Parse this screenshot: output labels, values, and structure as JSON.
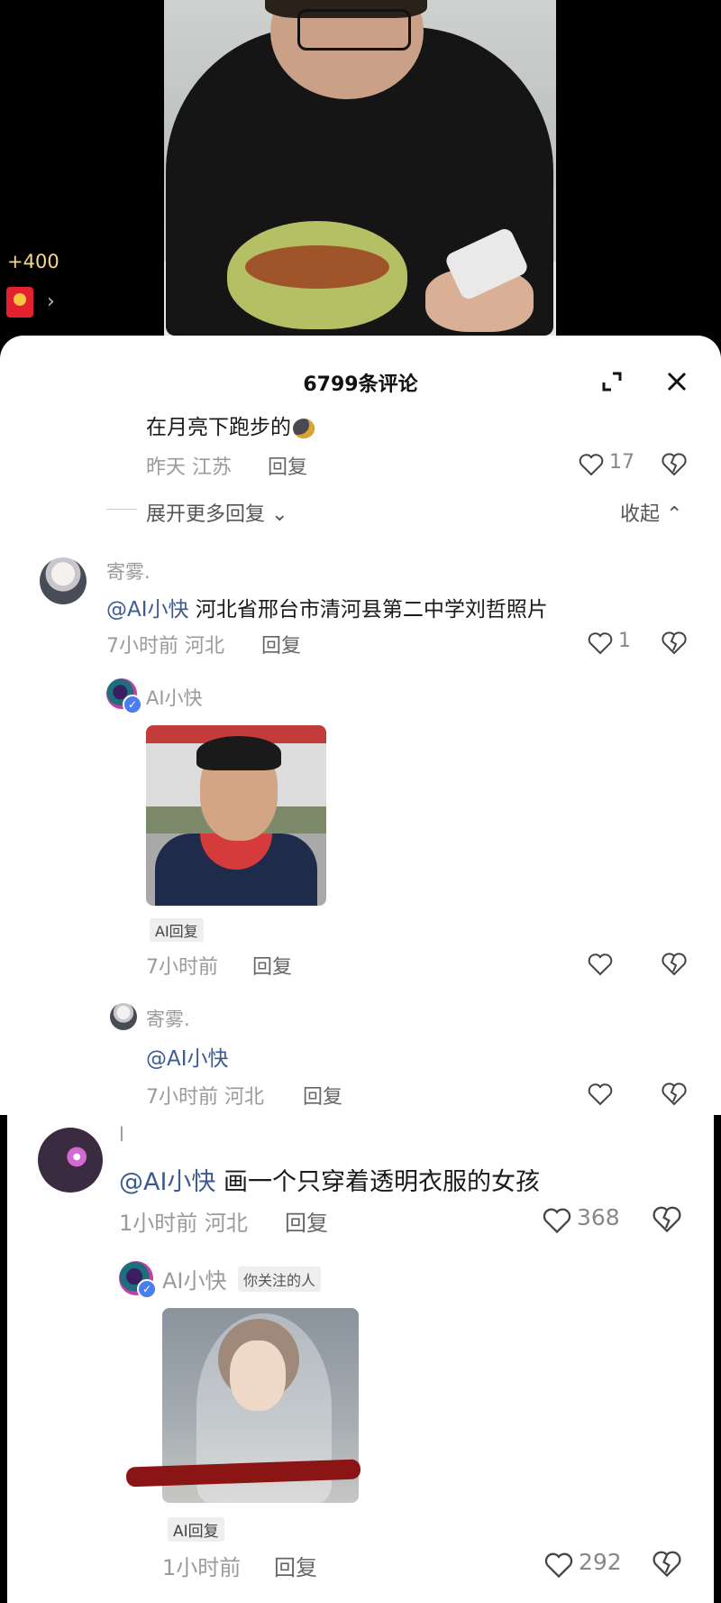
{
  "video": {
    "bonus": "+400",
    "arrow": "›"
  },
  "sheet": {
    "title": "6799条评论"
  },
  "top_comment": {
    "text": "在月亮下跑步的",
    "time": "昨天",
    "location": "江苏",
    "reply": "回复",
    "likes": "17",
    "expand_more": "展开更多回复",
    "collapse": "收起"
  },
  "comment1": {
    "user": "寄雾.",
    "mention": "@AI小快",
    "text": " 河北省邢台市清河县第二中学刘哲照片",
    "time": "7小时前",
    "location": "河北",
    "reply": "回复",
    "likes": "1"
  },
  "ai_reply1": {
    "user": "AI小快",
    "badge": "AI回复",
    "time": "7小时前",
    "reply": "回复"
  },
  "sub_reply": {
    "user": "寄雾.",
    "mention": "@AI小快",
    "time": "7小时前",
    "location": "河北",
    "reply": "回复"
  },
  "comment2": {
    "user": "l",
    "mention": "@AI小快",
    "text": " 画一个只穿着透明衣服的女孩",
    "time": "1小时前",
    "location": "河北",
    "reply": "回复",
    "likes": "368"
  },
  "ai_reply2": {
    "user": "AI小快",
    "follow_badge": "你关注的人",
    "badge": "AI回复",
    "time": "1小时前",
    "reply": "回复",
    "likes": "292"
  }
}
